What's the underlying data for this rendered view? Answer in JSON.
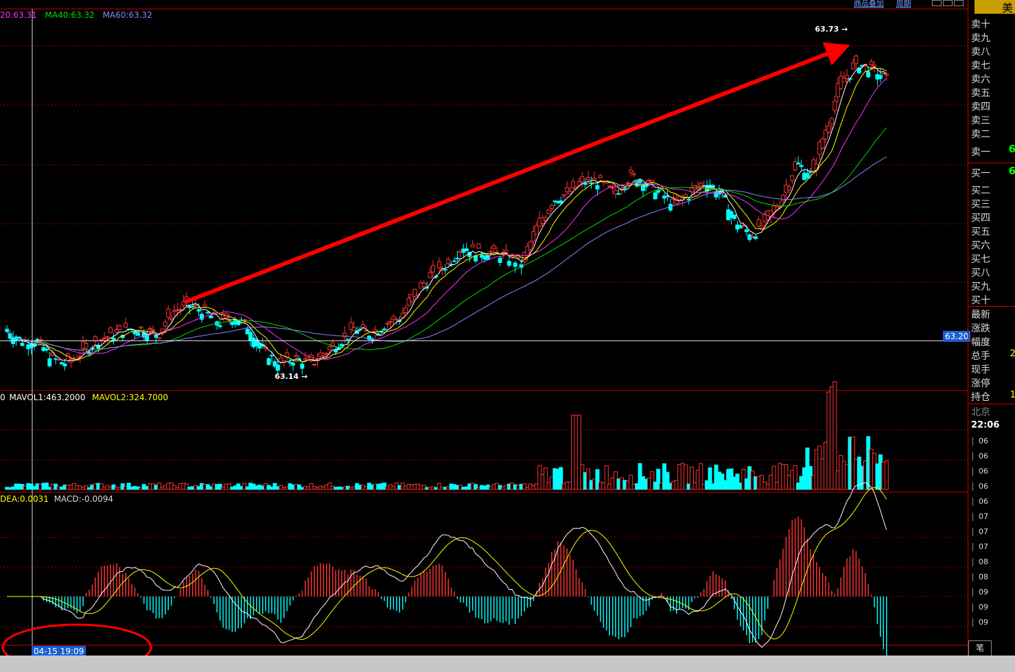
{
  "header": {
    "links": [
      "商品叠加",
      "周期"
    ],
    "ma_legend": [
      {
        "text": "20:63.31",
        "color": "#ff33ff"
      },
      {
        "text": "MA40:63.32",
        "color": "#00dd00"
      },
      {
        "text": "MA60:63.32",
        "color": "#8888ff"
      }
    ],
    "vol_legend": {
      "prefix": "0",
      "mavol1": "MAVOL1:463.2000",
      "mavol2": "MAVOL2:324.7000"
    },
    "macd_legend": {
      "dea": "DEA:0.0031",
      "macd": "MACD:-0.0094"
    }
  },
  "markers": {
    "high_label": "63.73",
    "low_label": "63.14",
    "current_price": "63.20",
    "crosshair_time": "04-15 19:09"
  },
  "colors": {
    "up": "#ff3333",
    "down": "#00ffff",
    "grid": "#a00000",
    "ma_short": "#ffffff",
    "ma10": "#ffff00",
    "ma20": "#ff33ff",
    "ma40": "#00dd00",
    "ma60": "#8888ff",
    "arrow": "#ff0000",
    "sidebar_value": "#00ff00"
  },
  "sidebar": {
    "title": "美",
    "asks": [
      "卖十",
      "卖九",
      "卖八",
      "卖七",
      "卖六",
      "卖五",
      "卖四",
      "卖三",
      "卖二",
      "卖一"
    ],
    "ask1_value": "6",
    "bids": [
      "买一",
      "买二",
      "买三",
      "买四",
      "买五",
      "买六",
      "买七",
      "买八",
      "买九",
      "买十"
    ],
    "bid1_value": "6",
    "stats": [
      "最新",
      "涨跌",
      "幅度",
      "总手",
      "现手",
      "涨停",
      "持仓"
    ],
    "stats_values": [
      "",
      "",
      "",
      "2",
      "",
      "",
      "1"
    ],
    "city": "北京",
    "time": "22:06",
    "ticks": [
      "06",
      "06",
      "06",
      "06",
      "06",
      "07",
      "07",
      "07",
      "08",
      "08",
      "09",
      "09",
      "09"
    ],
    "tab": "笔"
  },
  "chart_data": {
    "type": "candlestick",
    "price_range": [
      63.14,
      63.73
    ],
    "high": 63.73,
    "low": 63.14,
    "current": 63.2,
    "closes": [
      63.22,
      63.2,
      63.2,
      63.17,
      63.16,
      63.18,
      63.2,
      63.21,
      63.22,
      63.22,
      63.21,
      63.25,
      63.26,
      63.25,
      63.23,
      63.24,
      63.22,
      63.18,
      63.16,
      63.17,
      63.16,
      63.18,
      63.2,
      63.22,
      63.21,
      63.23,
      63.24,
      63.28,
      63.31,
      63.33,
      63.36,
      63.35,
      63.35,
      63.34,
      63.33,
      63.39,
      63.44,
      63.45,
      63.47,
      63.47,
      63.45,
      63.48,
      63.47,
      63.45,
      63.43,
      63.45,
      63.47,
      63.45,
      63.4,
      63.38,
      63.4,
      63.44,
      63.5,
      63.48,
      63.56,
      63.64,
      63.67,
      63.66,
      63.64
    ],
    "volume_scale": [
      0,
      2000
    ],
    "macd_scale": [
      -0.06,
      0.08
    ]
  }
}
